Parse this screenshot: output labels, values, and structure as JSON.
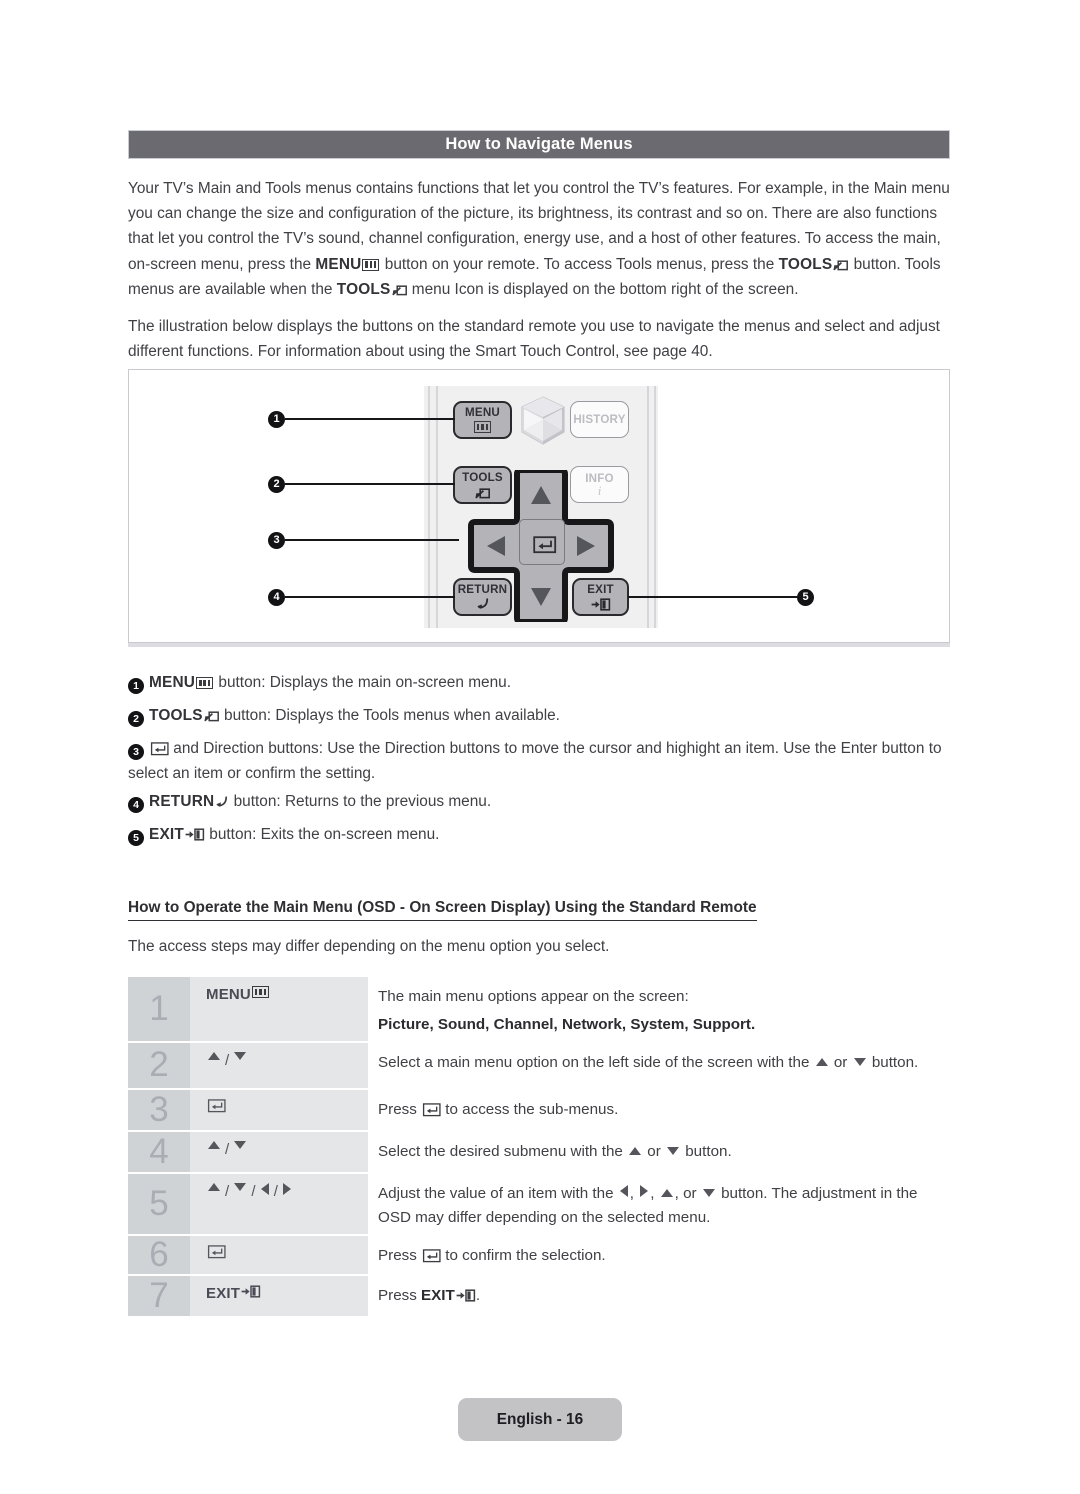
{
  "section": {
    "title": "How to Navigate Menus"
  },
  "paragraphs": {
    "p1_a": "Your TV’s Main and Tools menus contains functions that let you control the TV’s features. For example, in the Main menu you can change the size and configuration of the picture, its brightness, its contrast and so on. There are also functions that let you control the TV’s sound, channel configuration, energy use, and a host of other features. To access the main, on-screen menu, press the ",
    "p1_menu": "MENU",
    "p1_b": " button on your remote. To access Tools menus, press the ",
    "p1_tools": "TOOLS",
    "p1_c": " button. Tools menus are available when the ",
    "p1_tools2": "TOOLS",
    "p1_d": " menu Icon is displayed on the bottom right of the screen.",
    "p2": "The illustration below displays the buttons on the standard remote you use to navigate the menus and select and adjust different functions. For information about using the Smart Touch Control, see page 40."
  },
  "remote": {
    "buttons": {
      "menu": "MENU",
      "tools": "TOOLS",
      "return": "RETURN",
      "exit": "EXIT",
      "history": "HISTORY",
      "info": "INFO",
      "info_sub": "i"
    },
    "callouts": [
      "1",
      "2",
      "3",
      "4",
      "5"
    ]
  },
  "descriptions": [
    {
      "num": "1",
      "key": "MENU",
      "key_icon": "menu-icon",
      "text": " button: Displays the main on-screen menu."
    },
    {
      "num": "2",
      "key": "TOOLS",
      "key_icon": "tools-icon",
      "text": " button: Displays the Tools menus when available."
    },
    {
      "num": "3",
      "key": "",
      "key_icon": "enter-icon",
      "text": " and Direction buttons: Use the Direction buttons to move the cursor and highight an item. Use the Enter button to select an item or confirm the setting."
    },
    {
      "num": "4",
      "key": "RETURN",
      "key_icon": "return-icon",
      "text": " button: Returns to the previous menu."
    },
    {
      "num": "5",
      "key": "EXIT",
      "key_icon": "exit-icon",
      "text": " button: Exits the on-screen menu."
    }
  ],
  "subsection": {
    "heading": "How to Operate the Main Menu (OSD - On Screen Display) Using the Standard Remote",
    "intro": "The access steps may differ depending on the menu option you select."
  },
  "steps": [
    {
      "num": "1",
      "key_label": "MENU",
      "key_icon": "menu-icon",
      "text_line1": "The main menu options appear on the screen:",
      "text_bold": "Picture, Sound, Channel, Network, System, Support."
    },
    {
      "num": "2",
      "key_label": "",
      "key_icon": "up-down-arrows",
      "text_a": "Select a main menu option on the left side of the screen with the ",
      "text_b": " or ",
      "text_c": " button."
    },
    {
      "num": "3",
      "key_label": "",
      "key_icon": "enter-icon",
      "text_a": "Press ",
      "text_c": " to access the sub-menus."
    },
    {
      "num": "4",
      "key_label": "",
      "key_icon": "up-down-arrows",
      "text_a": "Select the desired submenu with the ",
      "text_b": " or ",
      "text_c": " button."
    },
    {
      "num": "5",
      "key_label": "",
      "key_icon": "four-direction-arrows",
      "text_a": "Adjust the value of an item with the ",
      "text_b": ", ",
      "text_c": ", ",
      "text_d": ", or ",
      "text_e": " button. The adjustment in the OSD may differ depending on the selected menu."
    },
    {
      "num": "6",
      "key_label": "",
      "key_icon": "enter-icon",
      "text_a": "Press ",
      "text_c": " to confirm the selection."
    },
    {
      "num": "7",
      "key_label": "EXIT",
      "key_icon": "exit-icon",
      "text_a": "Press ",
      "text_bold": "EXIT",
      "text_c": "."
    }
  ],
  "footer": {
    "label": "English - 16"
  },
  "colors": {
    "header_bar": "#6a6a70",
    "step_number_bg": "#d0d3d6",
    "step_key_bg": "#e4e6e8",
    "footer_bg": "#c3c3c6",
    "callout_bg": "#131316"
  }
}
